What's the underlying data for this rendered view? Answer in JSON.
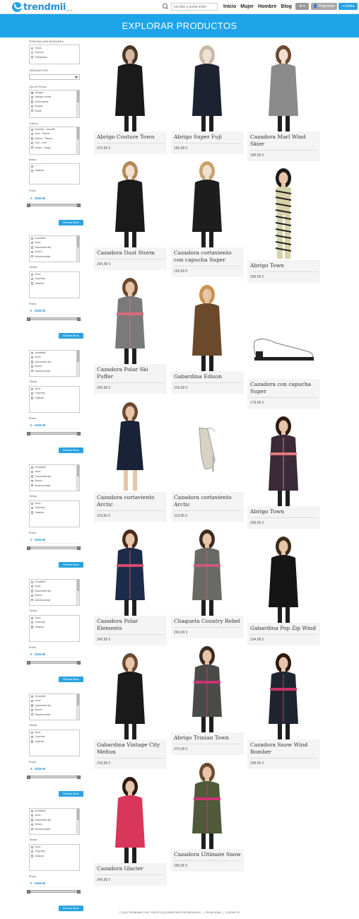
{
  "header": {
    "logo_text": "trendmii",
    "logo_sub": "beta",
    "search_placeholder": "escribe y pulsa enter",
    "nav": [
      "Inicio",
      "Mujer",
      "Hombre",
      "Blog"
    ],
    "register_label": "Registrate",
    "login_label": "Entra",
    "gear_icon": "gear-icon"
  },
  "banner": {
    "title": "EXPLORAR PRODUCTOS"
  },
  "sidebar": {
    "personalize_label": "PERSONALIZAR BÚSQUEDA",
    "search_options": [
      "Todos",
      "Nuevos",
      "Rebajados"
    ],
    "order_label": "ORDENAR POR",
    "type_label": "Tipo de Prenda",
    "types": [
      "Abrigos",
      "Abrigos cortos",
      "Americanas",
      "Blusas",
      "Botas"
    ],
    "colors_label": "Colores",
    "colors": [
      "Amarillo - Amarillo",
      "Azul - Marino",
      "Blanco - Blanco",
      "Gris - Gris",
      "Negro - Negro"
    ],
    "brand_label": "Marca",
    "brands": [
      "Zalando"
    ],
    "price_label": "Precio",
    "price_range": "0 - 2629.95",
    "filter_button": "Eliminar filtros",
    "brand_list": [
      "Annafield",
      "Asos",
      "Assomaternity",
      "Bench",
      "Bestmountain"
    ],
    "store_label": "Tienda",
    "stores": [
      "Asos",
      "Superdry",
      "Zalando"
    ]
  },
  "products": [
    {
      "name": "Abrigo Couture Town",
      "price": "374,99 €"
    },
    {
      "name": "Abrigo Super Fuji",
      "price": "189,99 €"
    },
    {
      "name": "Cazadora Marl Wind Skier",
      "price": "189,99 €"
    },
    {
      "name": "Cazadora Dust Storm",
      "price": "204,99 €"
    },
    {
      "name": "Cazadora cortaviento con capucha Super",
      "price": "159,99 €"
    },
    {
      "name": "Abrigo Town",
      "price": "299,95 €"
    },
    {
      "name": "Cazadora Polar Ski Puffer",
      "price": "249,95 €"
    },
    {
      "name": "Gabardina Edison",
      "price": "219,99 €"
    },
    {
      "name": "Cazadora con capucha Super",
      "price": "179,95 €"
    },
    {
      "name": "Cazadora cortaviento Arctic",
      "price": "119,95 €"
    },
    {
      "name": "Cazadora cortaviento Arctic",
      "price": "119,95 €"
    },
    {
      "name": "Abrigo Town",
      "price": "299,95 €"
    },
    {
      "name": "Cazadora Polar Elements",
      "price": "249,95 €"
    },
    {
      "name": "Chaqueta Country Rebel",
      "price": "264,99 €"
    },
    {
      "name": "Gabardina Pop Zip Wind",
      "price": "104,99 €"
    },
    {
      "name": "Gabardina Vintage City Melton",
      "price": "219,99 €"
    },
    {
      "name": "Abrigo Trinian Town",
      "price": "374,99 €"
    },
    {
      "name": "Cazadora Snow Wind Bomber",
      "price": "299,95 €"
    },
    {
      "name": "Cazadora Glacier",
      "price": "249,95 €"
    },
    {
      "name": "Cazadora Ultimate Snow",
      "price": "299,95 €"
    }
  ],
  "footer": {
    "copyright": "© 2013 TRENDMII.COM. TODOS LOS DERECHOS RESERVADOS.",
    "privacy": "PRIVACIDAD",
    "contact": "CONTACTO"
  }
}
